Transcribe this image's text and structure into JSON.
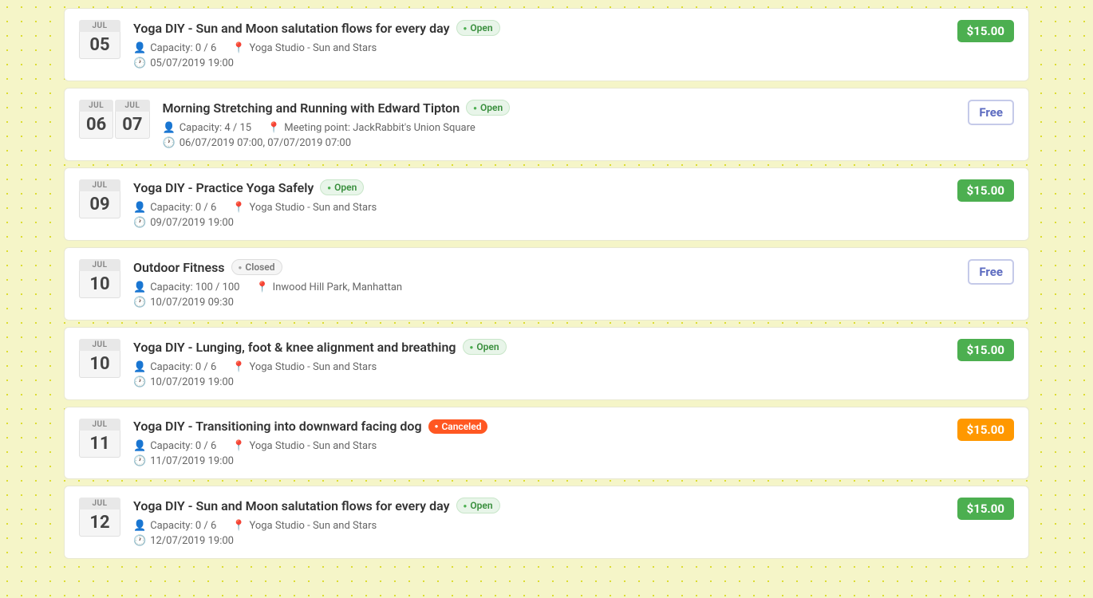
{
  "events": [
    {
      "id": "evt1",
      "month": "JUL",
      "day": "05",
      "double_date": false,
      "month2": null,
      "day2": null,
      "title": "Yoga DIY - Sun and Moon salutation flows for every day",
      "status": "Open",
      "status_type": "open",
      "capacity": "Capacity: 0 / 6",
      "location": "Yoga Studio - Sun and Stars",
      "datetime": "05/07/2019 19:00",
      "price": "$15.00",
      "price_type": "green"
    },
    {
      "id": "evt2",
      "month": "JUL",
      "day": "06",
      "double_date": true,
      "month2": "JUL",
      "day2": "07",
      "title": "Morning Stretching and Running with Edward Tipton",
      "status": "Open",
      "status_type": "open",
      "capacity": "Capacity: 4 / 15",
      "location": "Meeting point: JackRabbit's Union Square",
      "datetime": "06/07/2019 07:00, 07/07/2019 07:00",
      "price": "Free",
      "price_type": "free"
    },
    {
      "id": "evt3",
      "month": "JUL",
      "day": "09",
      "double_date": false,
      "month2": null,
      "day2": null,
      "title": "Yoga DIY - Practice Yoga Safely",
      "status": "Open",
      "status_type": "open",
      "capacity": "Capacity: 0 / 6",
      "location": "Yoga Studio - Sun and Stars",
      "datetime": "09/07/2019 19:00",
      "price": "$15.00",
      "price_type": "green"
    },
    {
      "id": "evt4",
      "month": "JUL",
      "day": "10",
      "double_date": false,
      "month2": null,
      "day2": null,
      "title": "Outdoor Fitness",
      "status": "Closed",
      "status_type": "closed",
      "capacity": "Capacity: 100 / 100",
      "location": "Inwood Hill Park, Manhattan",
      "datetime": "10/07/2019 09:30",
      "price": "Free",
      "price_type": "free"
    },
    {
      "id": "evt5",
      "month": "JUL",
      "day": "10",
      "double_date": false,
      "month2": null,
      "day2": null,
      "title": "Yoga DIY - Lunging, foot & knee alignment and breathing",
      "status": "Open",
      "status_type": "open",
      "capacity": "Capacity: 0 / 6",
      "location": "Yoga Studio - Sun and Stars",
      "datetime": "10/07/2019 19:00",
      "price": "$15.00",
      "price_type": "green"
    },
    {
      "id": "evt6",
      "month": "JUL",
      "day": "11",
      "double_date": false,
      "month2": null,
      "day2": null,
      "title": "Yoga DIY - Transitioning into downward facing dog",
      "status": "Canceled",
      "status_type": "canceled",
      "capacity": "Capacity: 0 / 6",
      "location": "Yoga Studio - Sun and Stars",
      "datetime": "11/07/2019 19:00",
      "price": "$15.00",
      "price_type": "orange"
    },
    {
      "id": "evt7",
      "month": "JUL",
      "day": "12",
      "double_date": false,
      "month2": null,
      "day2": null,
      "title": "Yoga DIY - Sun and Moon salutation flows for every day",
      "status": "Open",
      "status_type": "open",
      "capacity": "Capacity: 0 / 6",
      "location": "Yoga Studio - Sun and Stars",
      "datetime": "12/07/2019 19:00",
      "price": "$15.00",
      "price_type": "green"
    }
  ],
  "icons": {
    "person": "👤",
    "location": "📍",
    "clock": "🕐"
  }
}
